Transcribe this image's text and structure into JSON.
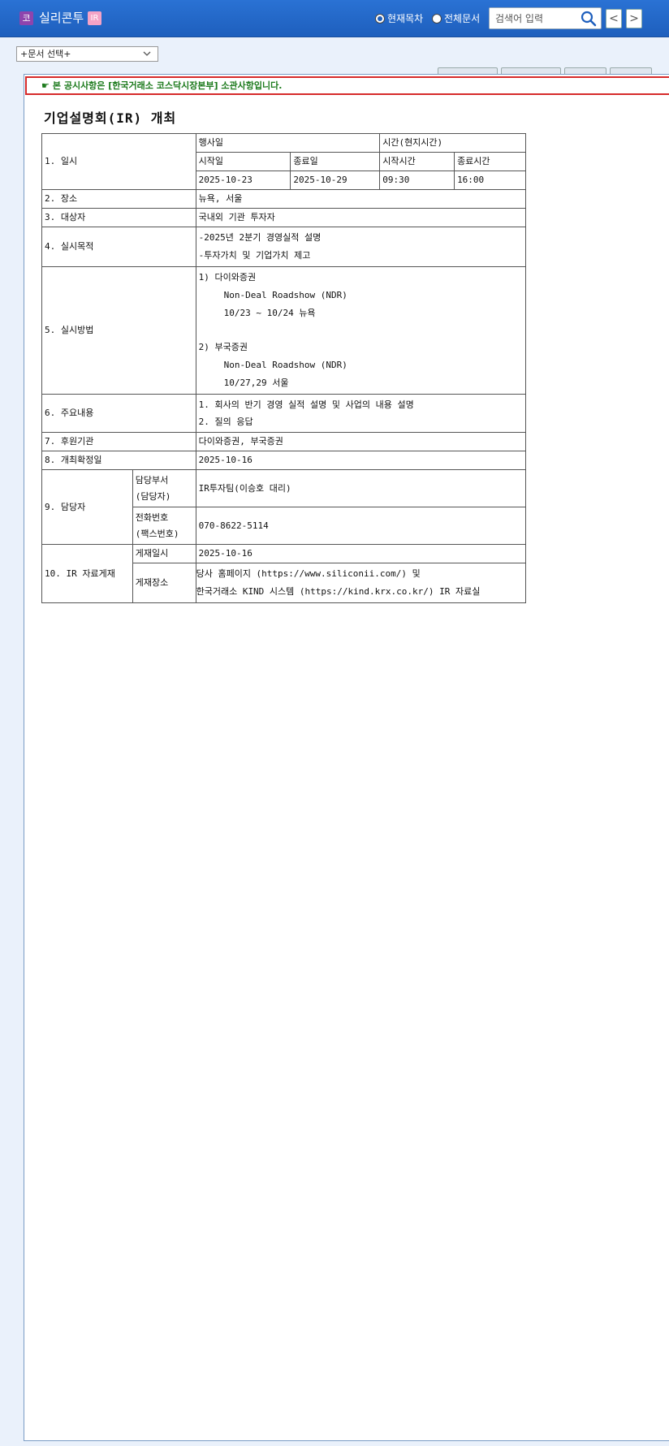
{
  "header": {
    "market_badge": "코",
    "company_name": "실리콘투",
    "ir_badge": "IR",
    "radio_current": "현재목차",
    "radio_all": "전체문서",
    "search_placeholder": "검색어 입력",
    "prev_label": "<",
    "next_label": ">"
  },
  "doc_select": {
    "value": "+문서 선택+"
  },
  "notice": {
    "prefix": "본 공시사항은 ",
    "highlight": "[한국거래소 코스닥시장본부]",
    "suffix": " 소관사항입니다."
  },
  "document": {
    "title": "기업설명회(IR) 개최",
    "rows": {
      "r1_label": "1. 일시",
      "event_day": "행사일",
      "local_time": "시간(현지시간)",
      "start_date_label": "시작일",
      "end_date_label": "종료일",
      "start_time_label": "시작시간",
      "end_time_label": "종료시간",
      "start_date": "2025-10-23",
      "end_date": "2025-10-29",
      "start_time": "09:30",
      "end_time": "16:00",
      "r2_label": "2. 장소",
      "r2_value": "뉴욕, 서울",
      "r3_label": "3. 대상자",
      "r3_value": "국내외 기관 투자자",
      "r4_label": "4. 실시목적",
      "r4_line1": "-2025년 2분기 경영실적 설명",
      "r4_line2": "-투자가치 및 기업가치 제고",
      "r5_label": "5. 실시방법",
      "r5_a_title": "1) 다이와증권",
      "r5_a_type": "Non-Deal Roadshow (NDR)",
      "r5_a_date": "10/23 ~ 10/24 뉴욕",
      "r5_b_title": "2) 부국증권",
      "r5_b_type": "Non-Deal Roadshow (NDR)",
      "r5_b_date": "10/27,29 서울",
      "r6_label": "6. 주요내용",
      "r6_line1": "1. 회사의 반기 경영 실적 설명 및 사업의 내용 설명",
      "r6_line2": "2. 질의 응답",
      "r7_label": "7. 후원기관",
      "r7_value": "다이와증권, 부국증권",
      "r8_label": "8. 개최확정일",
      "r8_value": "2025-10-16",
      "r9_label": "9. 담당자",
      "r9_dept_label_1": "담당부서",
      "r9_dept_label_2": "(담당자)",
      "r9_dept_value": "IR투자팀(이승호 대리)",
      "r9_phone_label_1": "전화번호",
      "r9_phone_label_2": "(팩스번호)",
      "r9_phone_value": "070-8622-5114",
      "r10_label": "10. IR 자료게재",
      "r10_date_label": "게재일시",
      "r10_date_value": "2025-10-16",
      "r10_place_label": "게재장소",
      "r10_place_line1": "당사 홈페이지 (https://www.siliconii.com/) 및",
      "r10_place_line2": "한국거래소 KIND 시스템 (https://kind.krx.co.kr/) IR 자료실"
    }
  }
}
